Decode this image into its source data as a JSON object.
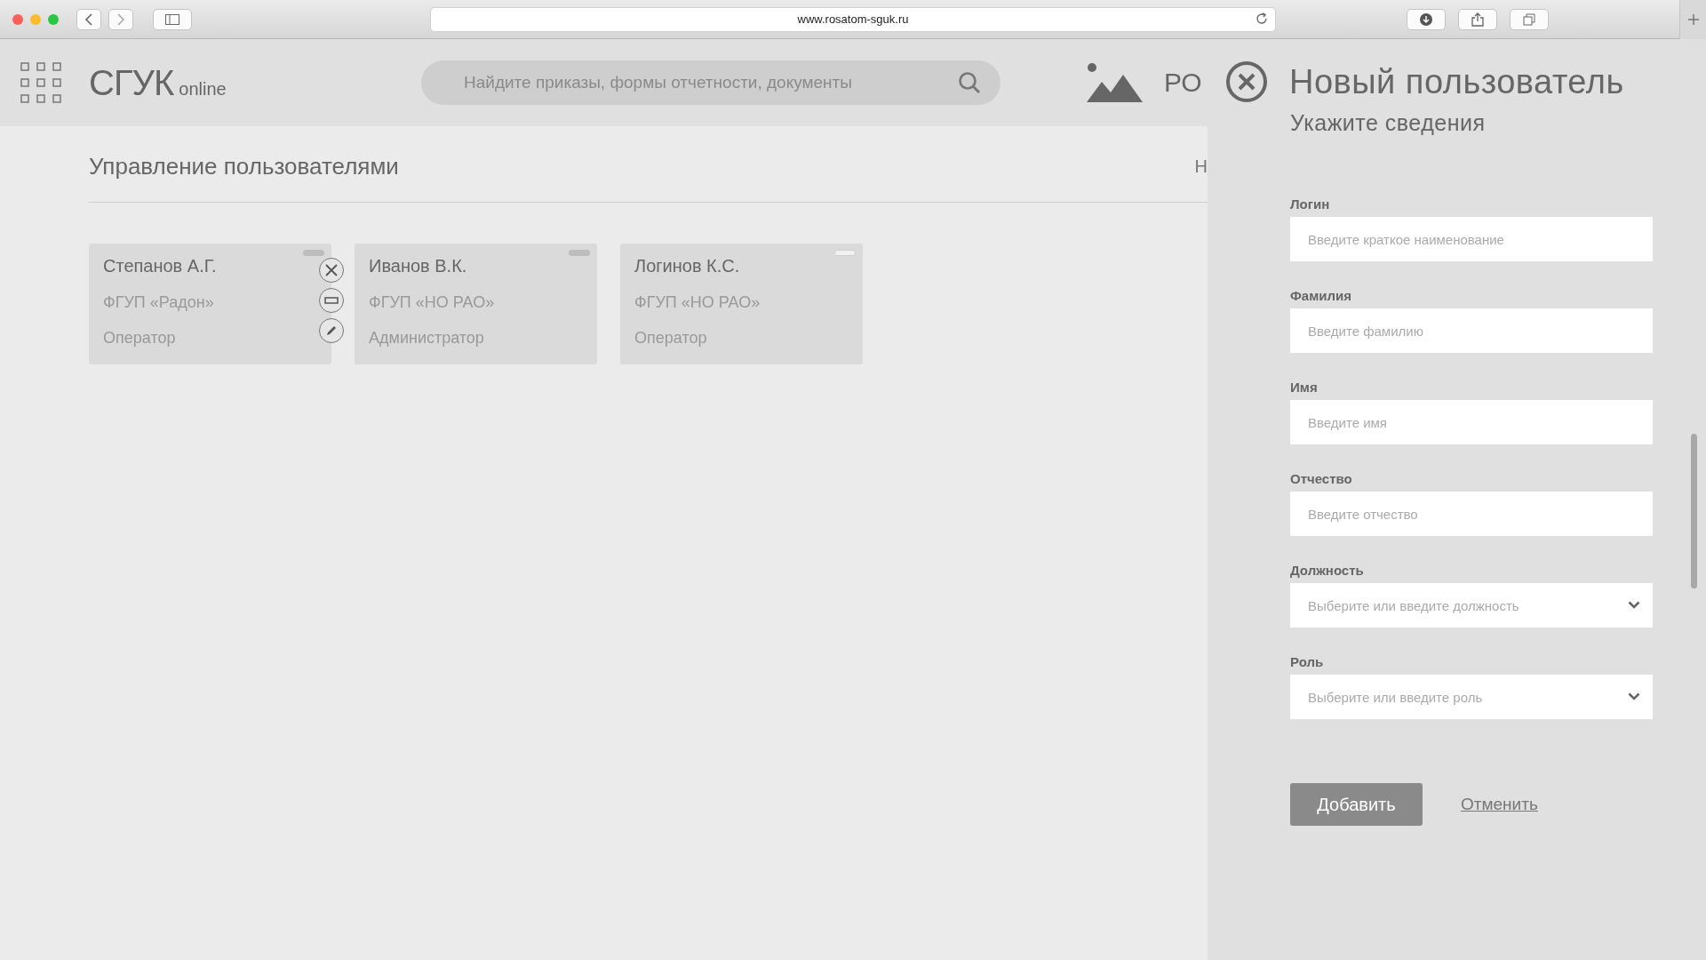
{
  "browser": {
    "url": "www.rosatom-sguk.ru"
  },
  "header": {
    "logo": "СГУК",
    "logo_suffix": "online",
    "search": {
      "placeholder": "Найдите приказы, формы отчетности, документы"
    },
    "brand_fragment": "РО"
  },
  "main": {
    "title": "Управление пользователями",
    "behind_text": "Н",
    "cards": [
      {
        "name": "Степанов А.Г.",
        "org": "ФГУП «Радон»",
        "role": "Оператор",
        "marker_filled": true,
        "actions_shown": true
      },
      {
        "name": "Иванов В.К.",
        "org": "ФГУП «НО РАО»",
        "role": "Администратор",
        "marker_filled": true,
        "actions_shown": false
      },
      {
        "name": "Логинов К.С.",
        "org": "ФГУП «НО РАО»",
        "role": "Оператор",
        "marker_filled": false,
        "actions_shown": false
      }
    ]
  },
  "drawer": {
    "title": "Новый пользователь",
    "subtitle": "Укажите сведения",
    "fields": [
      {
        "kind": "text",
        "label": "Логин",
        "placeholder": "Введите краткое наименование"
      },
      {
        "kind": "text",
        "label": "Фамилия",
        "placeholder": "Введите фамилию"
      },
      {
        "kind": "text",
        "label": "Имя",
        "placeholder": "Введите имя"
      },
      {
        "kind": "text",
        "label": "Отчество",
        "placeholder": "Введите отчество"
      },
      {
        "kind": "select",
        "label": "Должность",
        "placeholder": "Выберите или введите должность"
      },
      {
        "kind": "select",
        "label": "Роль",
        "placeholder": "Выберите или введите роль"
      }
    ],
    "submit": "Добавить",
    "cancel": "Отменить"
  }
}
